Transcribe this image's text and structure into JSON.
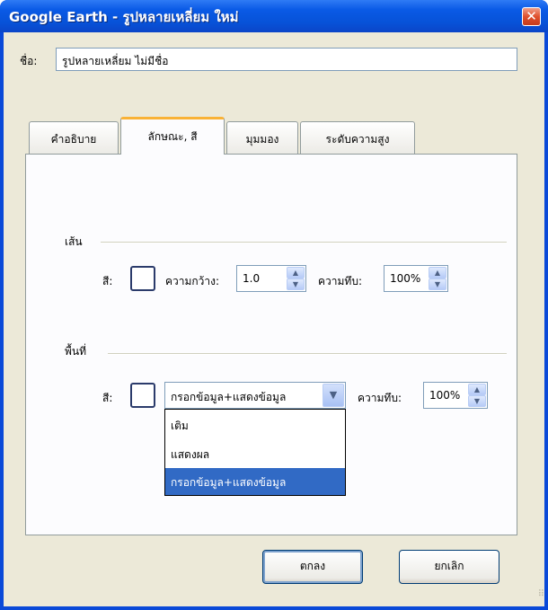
{
  "window": {
    "title": "Google Earth - รูปหลายเหลี่ยม ใหม่",
    "close_glyph": "✕"
  },
  "name_field": {
    "label": "ชื่อ:",
    "value": "รูปหลายเหลี่ยม ไม่มีชื่อ"
  },
  "tabs": [
    {
      "label": "คำอธิบาย",
      "active": false
    },
    {
      "label": "ลักษณะ, สี",
      "active": true
    },
    {
      "label": "มุมมอง",
      "active": false
    },
    {
      "label": "ระดับความสูง",
      "active": false
    }
  ],
  "line_group": {
    "title": "เส้น",
    "color_label": "สี:",
    "width_label": "ความกว้าง:",
    "width_value": "1.0",
    "opacity_label": "ความทึบ:",
    "opacity_value": "100%"
  },
  "area_group": {
    "title": "พื้นที่",
    "color_label": "สี:",
    "fill_mode_value": "กรอกข้อมูล+แสดงข้อมูล",
    "fill_mode_options": [
      "เติม",
      "แสดงผล",
      "กรอกข้อมูล+แสดงข้อมูล"
    ],
    "opacity_label": "ความทึบ:",
    "opacity_value": "100%"
  },
  "buttons": {
    "ok": "ตกลง",
    "cancel": "ยกเลิก"
  },
  "colors": {
    "titlebar": "#0a5ae6",
    "client_bg": "#ece9d8",
    "active_tab_accent": "#f9b236",
    "selection": "#316ac5"
  }
}
